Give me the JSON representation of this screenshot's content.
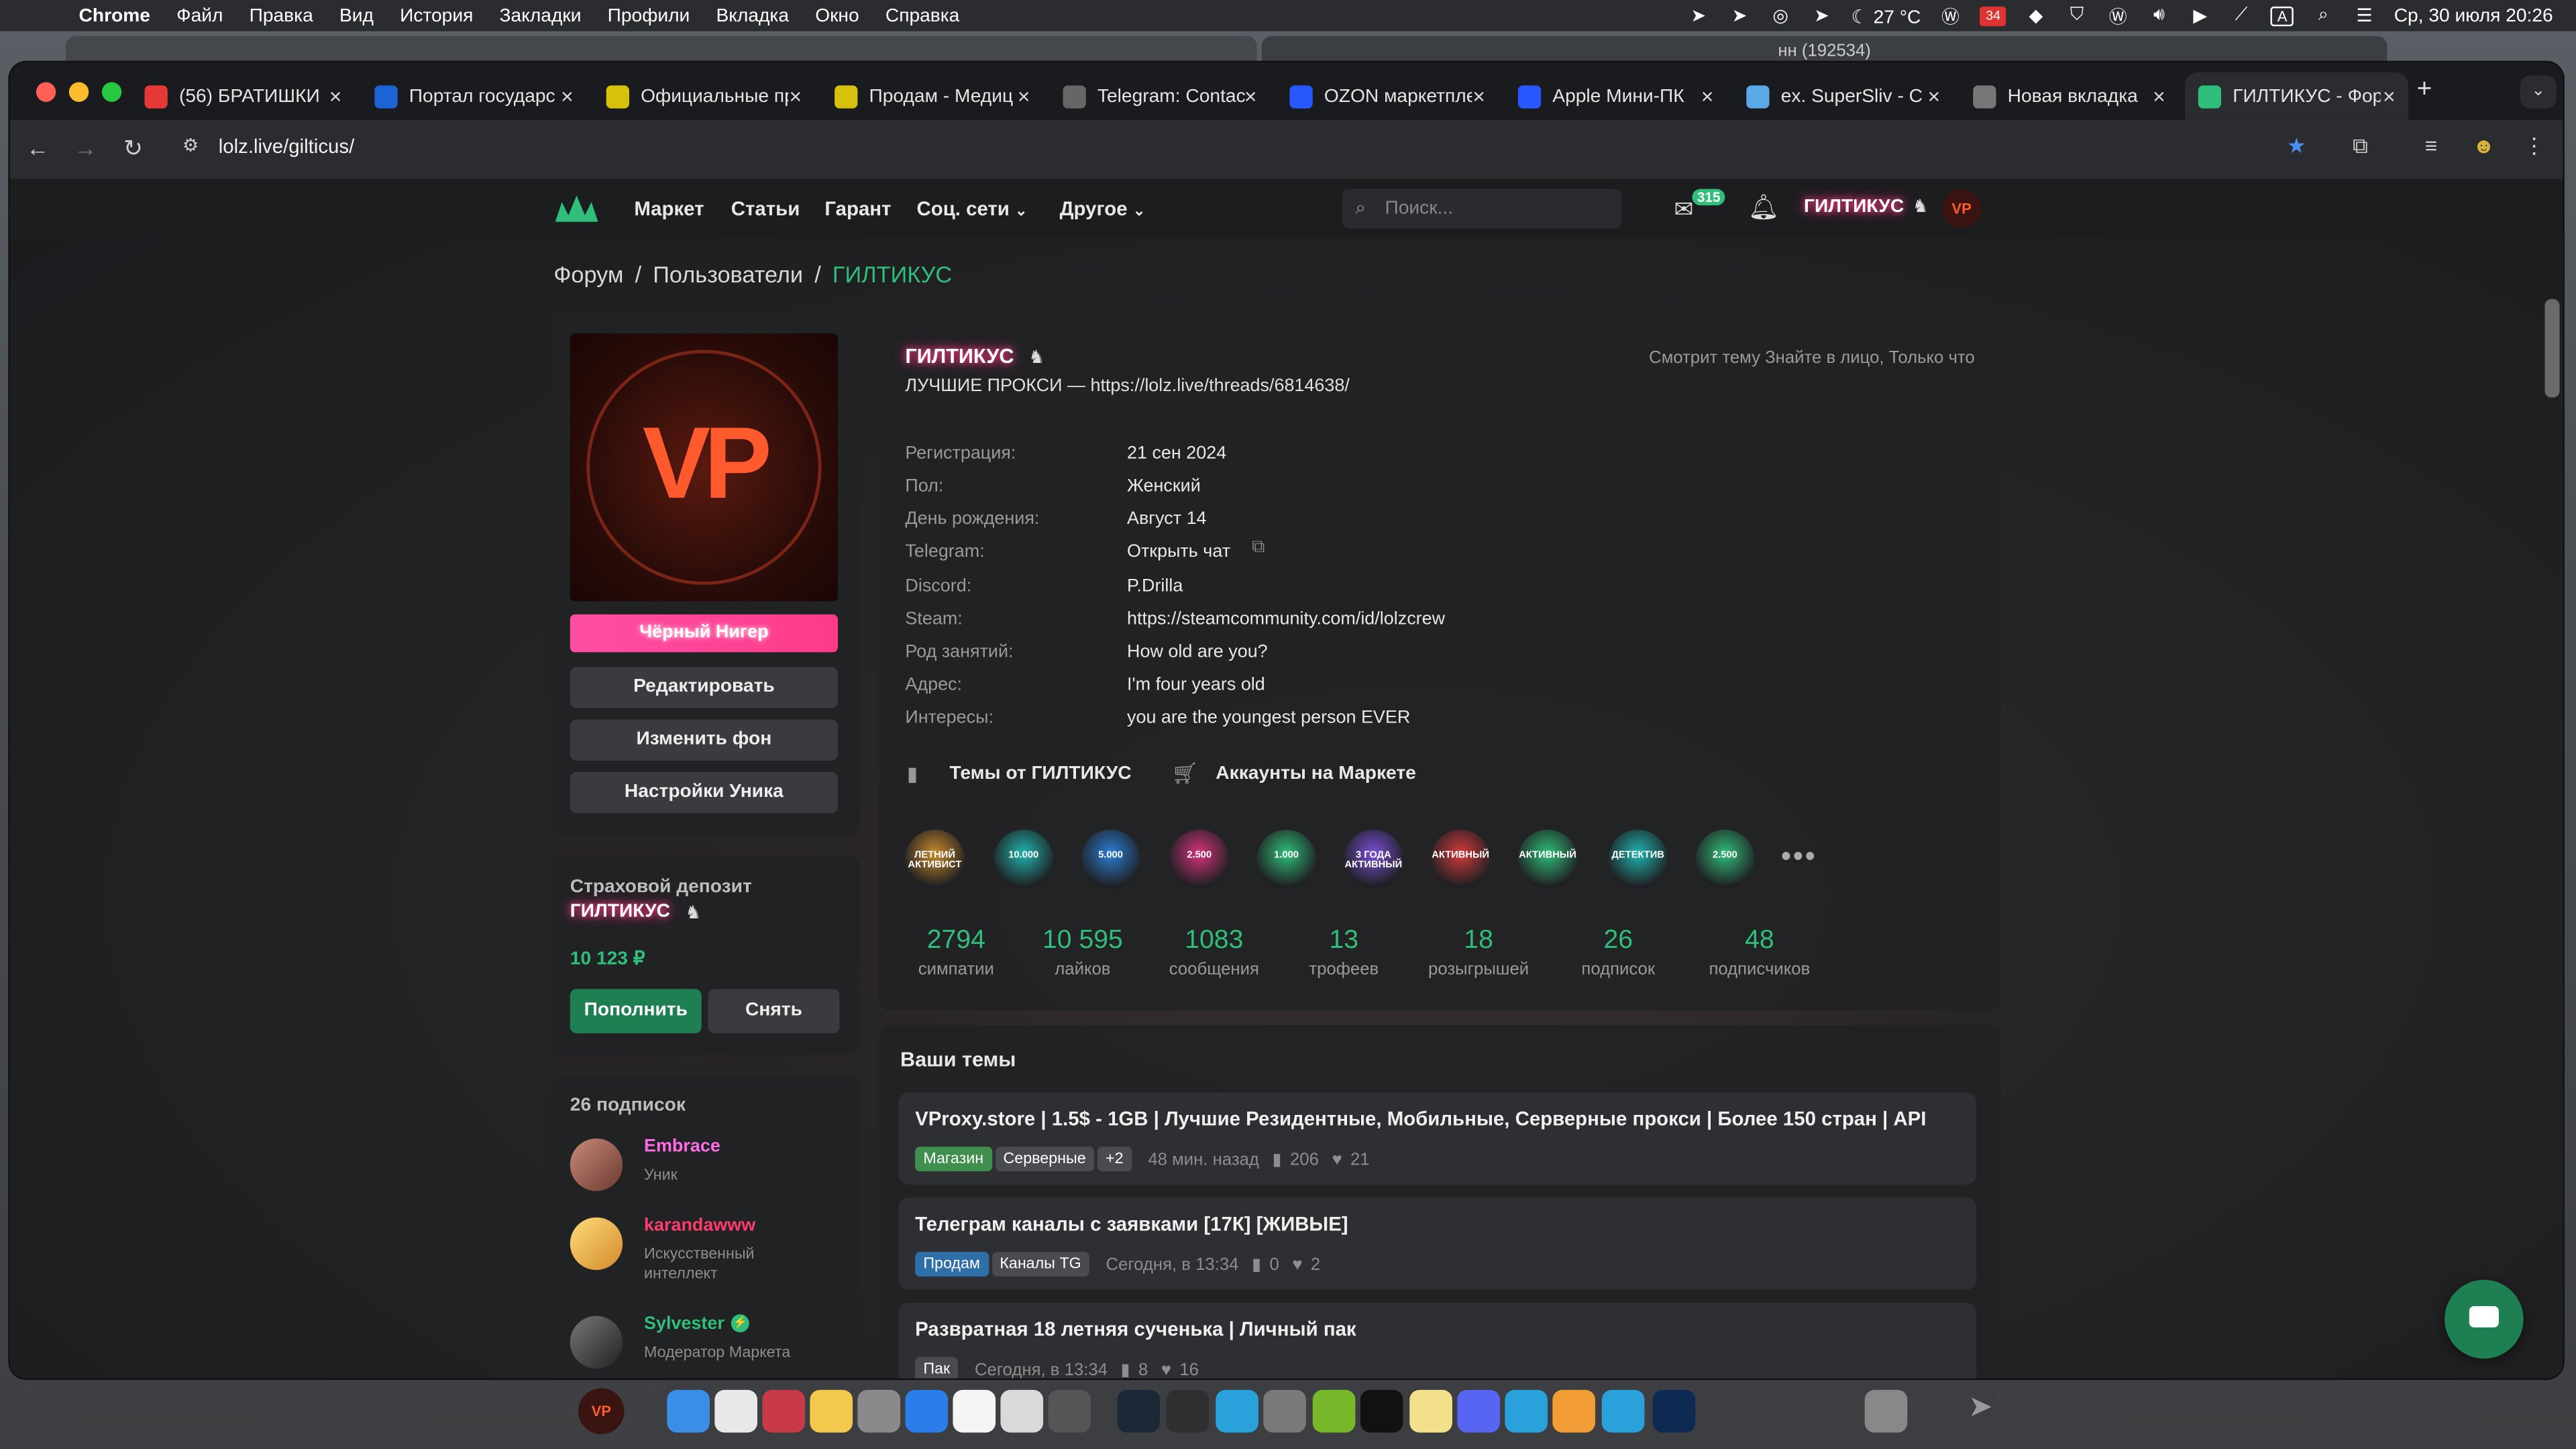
{
  "menubar": {
    "app": "Chrome",
    "items": [
      "Файл",
      "Правка",
      "Вид",
      "История",
      "Закладки",
      "Профили",
      "Вкладка",
      "Окно",
      "Справка"
    ],
    "weather": "27 °C",
    "calendar_badge": "34",
    "clock": "Ср, 30 июля  20:26"
  },
  "ghost_window": {
    "title": "нн (192534)"
  },
  "tabs": [
    {
      "title": "(56) БРАТИШКИ",
      "icon": "youtube-icon",
      "color": "#e53935"
    },
    {
      "title": "Портал государс",
      "icon": "flag-ru-icon",
      "color": "#1c64d6"
    },
    {
      "title": "Официальные пр",
      "icon": "d-icon",
      "color": "#d8c10b"
    },
    {
      "title": "Продам - Медиц",
      "icon": "d-icon",
      "color": "#d8c10b"
    },
    {
      "title": "Telegram: Contac",
      "icon": "globe-icon",
      "color": "#666"
    },
    {
      "title": "OZON маркетпле",
      "icon": "ozon-icon",
      "color": "#2758ff"
    },
    {
      "title": "Apple Мини-ПК",
      "icon": "ozon-icon",
      "color": "#2758ff"
    },
    {
      "title": "ex. SuperSliv - C",
      "icon": "supersliv-icon",
      "color": "#5aa9e6"
    },
    {
      "title": "Новая вкладка",
      "icon": "chrome-icon",
      "color": "#777"
    },
    {
      "title": "ГИЛТИКУС - Фор",
      "icon": "lolz-icon",
      "color": "#2fbf7a"
    }
  ],
  "address": "lolz.live/gilticus/",
  "site": {
    "nav": [
      "Маркет",
      "Статьи",
      "Гарант",
      "Соц. сети",
      "Другое"
    ],
    "search_placeholder": "Поиск...",
    "messages_count": "315",
    "username": "ГИЛТИКУС",
    "avatar_text": "VP"
  },
  "breadcrumbs": [
    "Форум",
    "Пользователи",
    "ГИЛТИКУС"
  ],
  "left": {
    "avatar_text": "VP",
    "title_bar": "Чёрный Нигер",
    "buttons": [
      "Редактировать",
      "Изменить фон",
      "Настройки Уника"
    ],
    "deposit_title": "Страховой депозит",
    "deposit_name": "ГИЛТИКУС",
    "deposit_amount": "10 123 ₽",
    "deposit_add": "Пополнить",
    "deposit_withdraw": "Снять",
    "subs_count": "26 подписок",
    "subs": [
      {
        "name": "Embrace",
        "role": "Уник",
        "color": "#ff6be6"
      },
      {
        "name": "karandawww",
        "role": "Искусственный интеллект",
        "color": "#ff3b6b"
      },
      {
        "name": "Sylvester",
        "role": "Модератор Маркета",
        "color": "#2fbf7a"
      }
    ]
  },
  "profile": {
    "name": "ГИЛТИКУС",
    "status": "Смотрит тему Знайте в лицо, Только что",
    "bio": "ЛУЧШИЕ ПРОКСИ — https://lolz.live/threads/6814638/",
    "fields": [
      {
        "label": "Регистрация:",
        "value": "21 сен 2024"
      },
      {
        "label": "Пол:",
        "value": "Женский"
      },
      {
        "label": "День рождения:",
        "value": "Август 14"
      },
      {
        "label": "Telegram:",
        "value": "Открыть чат"
      },
      {
        "label": "Discord:",
        "value": "P.Drilla"
      },
      {
        "label": "Steam:",
        "value": "https://steamcommunity.com/id/lolzcrew"
      },
      {
        "label": "Род занятий:",
        "value": "How old are you?"
      },
      {
        "label": "Адрес:",
        "value": "I'm four years old"
      },
      {
        "label": "Интересы:",
        "value": "you are the youngest person EVER"
      }
    ],
    "links": [
      "Темы от ГИЛТИКУС",
      "Аккаунты на Маркете"
    ],
    "badges": [
      {
        "label": "ЛЕТНИЙ АКТИВИСТ",
        "color": "#c98a2b"
      },
      {
        "label": "10.000",
        "color": "#1fb5b0"
      },
      {
        "label": "5.000",
        "color": "#2a7fd6"
      },
      {
        "label": "2.500",
        "color": "#d6337c"
      },
      {
        "label": "1.000",
        "color": "#2fbf7a"
      },
      {
        "label": "3 ГОДА АКТИВНЫЙ",
        "color": "#7b4fd6"
      },
      {
        "label": "АКТИВНЫЙ",
        "color": "#d63a3a"
      },
      {
        "label": "АКТИВНЫЙ",
        "color": "#2fbf7a"
      },
      {
        "label": "ДЕТЕКТИВ",
        "color": "#1fb5b0"
      },
      {
        "label": "2.500",
        "color": "#2fbf7a"
      }
    ],
    "stats": [
      {
        "n": "2794",
        "t": "симпатии"
      },
      {
        "n": "10 595",
        "t": "лайков"
      },
      {
        "n": "1083",
        "t": "сообщения"
      },
      {
        "n": "13",
        "t": "трофеев"
      },
      {
        "n": "18",
        "t": "розыгрышей"
      },
      {
        "n": "26",
        "t": "подписок"
      },
      {
        "n": "48",
        "t": "подписчиков"
      }
    ]
  },
  "topics": {
    "heading": "Ваши темы",
    "items": [
      {
        "title": "VProxy.store | 1.5$ - 1GB | Лучшие Резидентные, Мобильные, Серверные прокси | Более 150 стран | API",
        "tags": [
          {
            "t": "Магазин",
            "c": "#3f8f4e"
          },
          {
            "t": "Серверные",
            "c": "#4a4b50"
          },
          {
            "t": "+2",
            "c": "#4a4b50"
          }
        ],
        "time": "48 мин. назад",
        "comments": "206",
        "likes": "21"
      },
      {
        "title": "Телеграм каналы с заявками [17К] [ЖИВЫЕ]",
        "tags": [
          {
            "t": "Продам",
            "c": "#2f6fa8"
          },
          {
            "t": "Каналы TG",
            "c": "#4a4b50"
          }
        ],
        "time": "Сегодня, в 13:34",
        "comments": "0",
        "likes": "2"
      },
      {
        "title": "Развратная 18 летняя сученька | Личный пак",
        "tags": [
          {
            "t": "Пак",
            "c": "#4a4b50"
          }
        ],
        "time": "Сегодня, в 13:34",
        "comments": "8",
        "likes": "16"
      }
    ]
  }
}
